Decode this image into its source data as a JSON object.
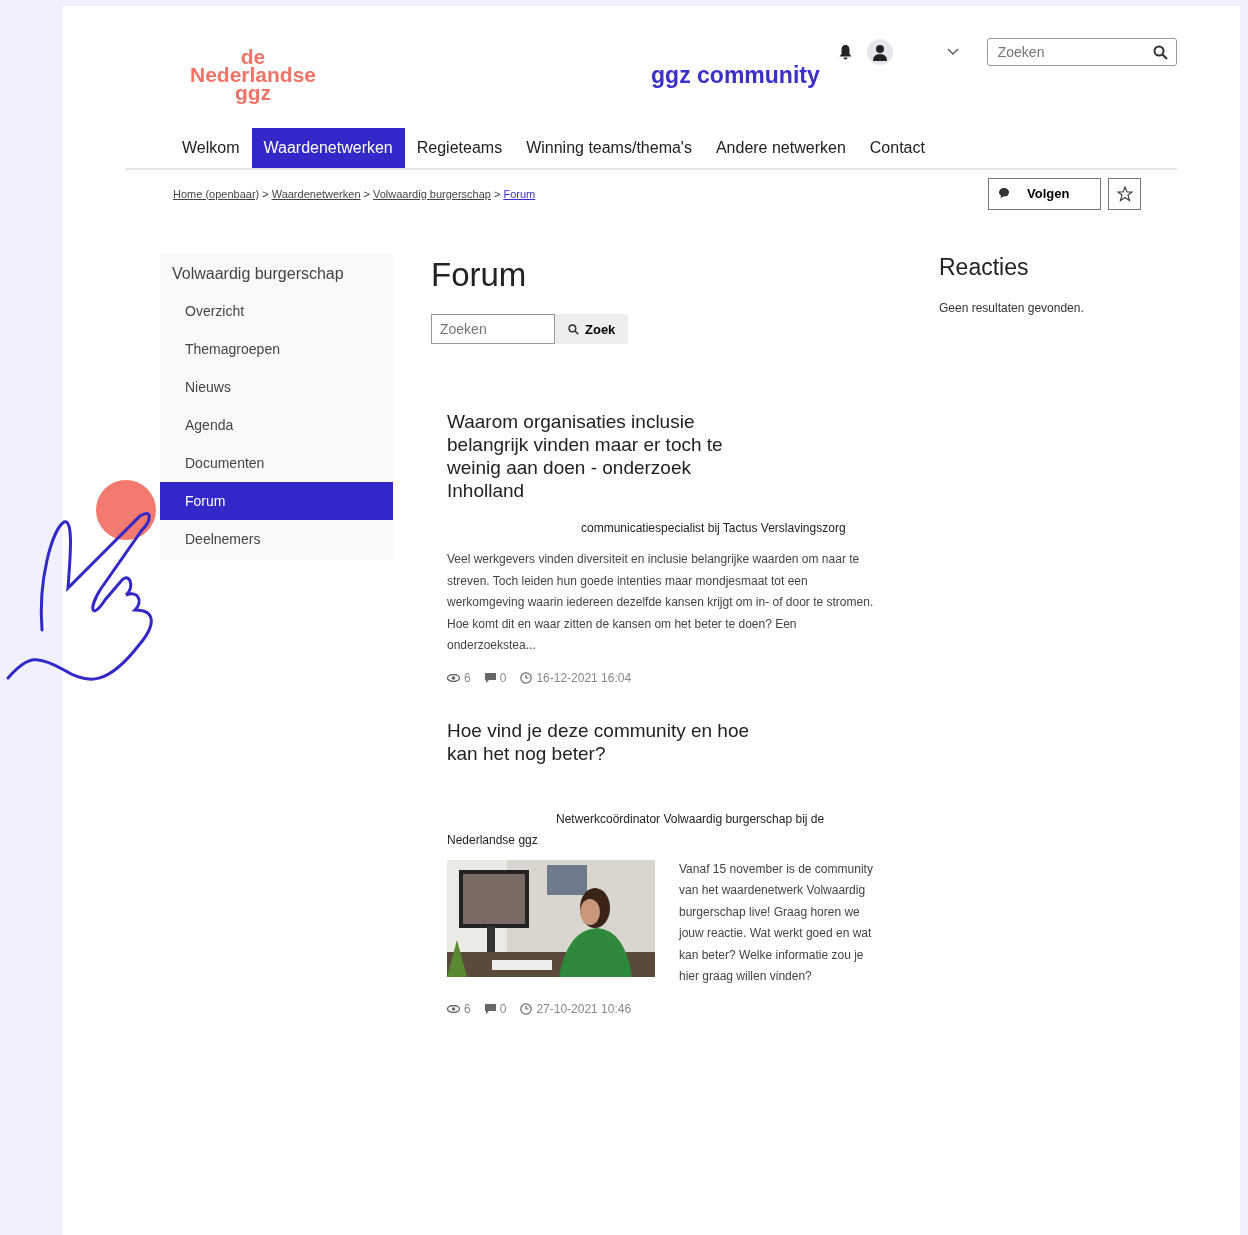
{
  "logo": {
    "lines": [
      "de",
      "Nederlandse",
      "ggz"
    ]
  },
  "site_title": "ggz community",
  "header_search": {
    "placeholder": "Zoeken"
  },
  "nav": [
    {
      "label": "Welkom",
      "selected": false
    },
    {
      "label": "Waardenetwerken",
      "selected": true
    },
    {
      "label": "Regieteams",
      "selected": false
    },
    {
      "label": "Winning teams/thema's",
      "selected": false
    },
    {
      "label": "Andere netwerken",
      "selected": false
    },
    {
      "label": "Contact",
      "selected": false
    }
  ],
  "breadcrumb_separator": ">",
  "breadcrumb": [
    {
      "label": "Home (openbaar)",
      "current": false
    },
    {
      "label": "Waardenetwerken",
      "current": false
    },
    {
      "label": "Volwaardig burgerschap",
      "current": false
    },
    {
      "label": "Forum",
      "current": true
    }
  ],
  "follow_button": "Volgen",
  "sidebar": {
    "title": "Volwaardig burgerschap",
    "items": [
      {
        "label": "Overzicht",
        "selected": false
      },
      {
        "label": "Themagroepen",
        "selected": false
      },
      {
        "label": "Nieuws",
        "selected": false
      },
      {
        "label": "Agenda",
        "selected": false
      },
      {
        "label": "Documenten",
        "selected": false
      },
      {
        "label": "Forum",
        "selected": true
      },
      {
        "label": "Deelnemers",
        "selected": false
      }
    ]
  },
  "page_title": "Forum",
  "forum_search": {
    "placeholder": "Zoeken",
    "button": "Zoek"
  },
  "posts": [
    {
      "kind": "text",
      "title": "Waarom organisaties inclusie belangrijk vinden maar er toch te weinig aan doen - onderzoek Inholland",
      "author_role": "communicatiespecialist bij Tactus Verslavingszorg",
      "excerpt": "Veel werkgevers vinden diversiteit en inclusie belangrijke waarden om naar te streven. Toch leiden hun goede intenties maar mondjesmaat tot een werkomgeving waarin iedereen dezelfde kansen krijgt om in- of door te stromen. Hoe komt dit en waar zitten de kansen om het beter te doen? Een onderzoekstea...",
      "views": "6",
      "comments": "0",
      "date": "16-12-2021 16:04"
    },
    {
      "title": "Hoe vind je deze community en hoe kan het nog beter?",
      "author_role": "Netwerkcoördinator Volwaardig burgerschap bij de Nederlandse ggz",
      "excerpt": "Vanaf 15 november is de community van het waardenetwerk Volwaardig burgerschap live! Graag horen we jouw reactie. Wat werkt goed en wat kan beter? Welke informatie zou je hier graag willen vinden?",
      "views": "6",
      "comments": "0",
      "date": "27-10-2021 10:46"
    }
  ],
  "reactions": {
    "title": "Reacties",
    "empty": "Geen resultaten gevonden."
  }
}
